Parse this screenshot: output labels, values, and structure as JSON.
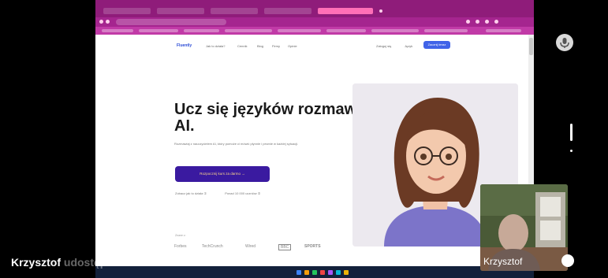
{
  "website": {
    "logo": "Fluently",
    "nav_items": [
      "Jak to działa?",
      "Cennik",
      "Blog",
      "Firmy",
      "Opinie"
    ],
    "login_label": "Zaloguj się",
    "language_label": "Język",
    "top_cta_label": "Zacznij teraz",
    "hero_title": "Ucz się języków rozmawiając z AI.",
    "hero_description": "Rozmawiaj z nauczycielem AI, który pomoże ci mówić płynnie i pewnie w każdej sytuacji.",
    "hero_cta_label": "Rozpocznij kurs za darmo →",
    "hero_link_1": "Zobacz jak to działa ①",
    "hero_link_2": "Ponad 10 000 uczniów ②",
    "brands_label": "Znane z:",
    "brands": [
      "Forbes",
      "TechCrunch",
      "Wired",
      "BBC",
      "SPORTS"
    ]
  },
  "meeting": {
    "participant_name": "Krzysztof",
    "caption_speaker": "Krzysztof",
    "caption_text": "udostępnia ekran"
  },
  "colors": {
    "browser_frame": "#8f1c7a",
    "accent": "#4063e8",
    "hero_button": "#3a1aa0"
  }
}
